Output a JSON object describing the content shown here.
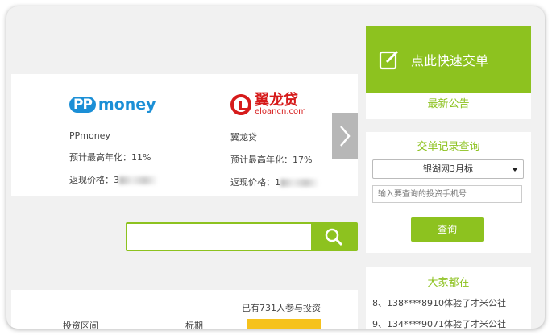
{
  "products": [
    {
      "logo_text": "money",
      "logo_prefix": "PP",
      "name": "PPmoney",
      "rate": "预计最高年化：11%",
      "cashback_label": "返现价格：3"
    },
    {
      "logo_text": "翼龙贷",
      "logo_sub": "eloancn.com",
      "name": "翼龙贷",
      "rate": "预计最高年化：17%",
      "cashback_label": "返现价格：1"
    }
  ],
  "search": {
    "placeholder": ""
  },
  "invest": {
    "count_text": "已有731人参与投资",
    "col_range": "投资区间",
    "col_term": "标期"
  },
  "sidebar": {
    "quick_order_label": "点此快速交单",
    "notice_label": "最新公告",
    "query_title": "交单记录查询",
    "select_value": "银湖网3月标",
    "phone_placeholder": "输入要查询的投资手机号",
    "query_button": "查询",
    "everyone_title": "大家都在",
    "feed": [
      "8、138****8910体验了才米公社",
      "9、134****9071体验了才米公社"
    ]
  },
  "colors": {
    "accent": "#8dc21f",
    "brand_red": "#d61b1b",
    "brand_blue": "#1b8fd6"
  }
}
